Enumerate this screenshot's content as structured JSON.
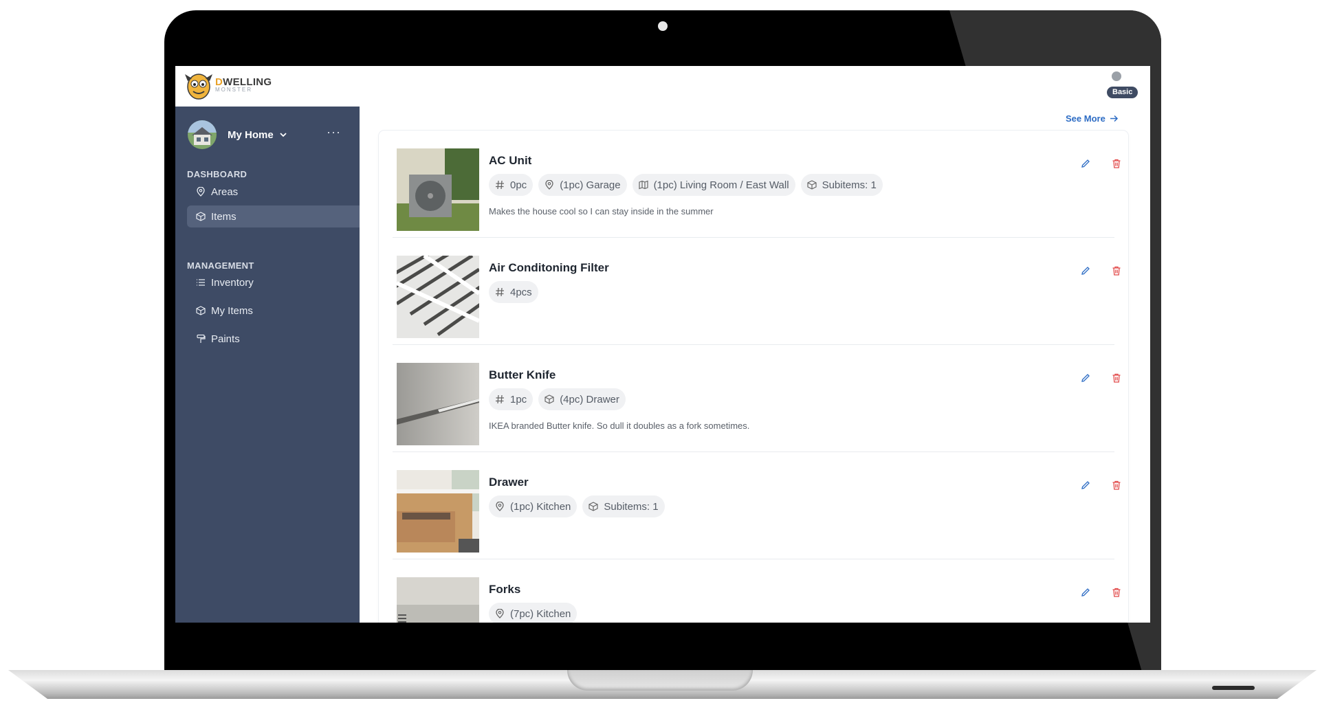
{
  "app": {
    "logo_text": "DWELLING",
    "logo_sub": "MONSTER",
    "plan_badge": "Basic"
  },
  "sidebar": {
    "home_name": "My Home",
    "more_label": "···",
    "sections": [
      {
        "title": "DASHBOARD",
        "items": [
          {
            "label": "Areas",
            "icon": "map-pin-icon"
          },
          {
            "label": "Items",
            "icon": "cube-icon",
            "active": true
          }
        ]
      },
      {
        "title": "MANAGEMENT",
        "items": [
          {
            "label": "Inventory",
            "icon": "list-icon"
          },
          {
            "label": "My Items",
            "icon": "cube-icon"
          },
          {
            "label": "Paints",
            "icon": "paint-roller-icon"
          }
        ]
      }
    ]
  },
  "main": {
    "see_more": "See More",
    "items": [
      {
        "name": "AC Unit",
        "chips": [
          {
            "icon": "hash-icon",
            "text": "0pc"
          },
          {
            "icon": "map-pin-icon",
            "text": "(1pc)  Garage"
          },
          {
            "icon": "map-icon",
            "text": "(1pc)  Living Room / East Wall"
          },
          {
            "icon": "cube-icon",
            "text": "Subitems: 1"
          }
        ],
        "description": "Makes the house cool so I can stay inside in the summer"
      },
      {
        "name": "Air Conditoning Filter",
        "chips": [
          {
            "icon": "hash-icon",
            "text": "4pcs"
          }
        ],
        "description": ""
      },
      {
        "name": "Butter Knife",
        "chips": [
          {
            "icon": "hash-icon",
            "text": "1pc"
          },
          {
            "icon": "cube-icon",
            "text": "(4pc)  Drawer"
          }
        ],
        "description": "IKEA branded Butter knife. So dull it doubles as a fork sometimes."
      },
      {
        "name": "Drawer",
        "chips": [
          {
            "icon": "map-pin-icon",
            "text": "(1pc)  Kitchen"
          },
          {
            "icon": "cube-icon",
            "text": "Subitems: 1"
          }
        ],
        "description": ""
      },
      {
        "name": "Forks",
        "chips": [
          {
            "icon": "map-pin-icon",
            "text": "(7pc)  Kitchen"
          }
        ],
        "description": ""
      }
    ]
  },
  "colors": {
    "sidebar": "#3e4b65",
    "accent_blue": "#2d6cc4",
    "delete_red": "#e24b4b"
  }
}
